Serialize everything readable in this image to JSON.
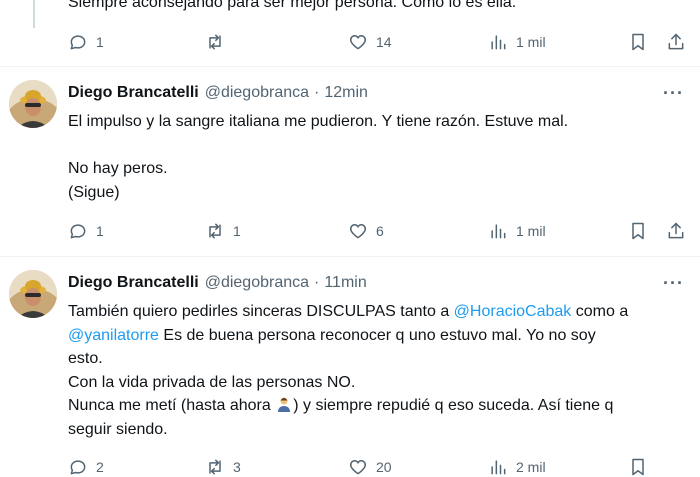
{
  "top_tweet": {
    "partial_text": "Siempre aconsejando para ser mejor persona. Como lo es ella.",
    "replies": "1",
    "retweets": "",
    "likes": "14",
    "views": "1 mil"
  },
  "tweets": [
    {
      "name": "Diego Brancatelli",
      "handle": "@diegobranca",
      "separator": "·",
      "time": "12min",
      "lines": [
        "El impulso y la sangre italiana me pudieron. Y tiene razón. Estuve mal.",
        "",
        "No hay peros.",
        "(Sigue)"
      ],
      "replies": "1",
      "retweets": "1",
      "likes": "6",
      "views": "1 mil"
    },
    {
      "name": "Diego Brancatelli",
      "handle": "@diegobranca",
      "separator": "·",
      "time": "11min",
      "text_a": "También quiero pedirles sinceras DISCULPAS tanto a ",
      "mention_1": "@HoracioCabak",
      "text_b": " como a",
      "mention_2": "@yanilatorre",
      "text_c": " Es de buena persona reconocer q uno estuvo mal. Yo no soy",
      "text_d": "esto.",
      "text_e": "Con la vida privada de las personas NO.",
      "text_f": "Nunca me metí (hasta ahora ",
      "text_g": ") y siempre repudié q eso suceda. Así tiene q",
      "text_h": "seguir siendo.",
      "replies": "2",
      "retweets": "3",
      "likes": "20",
      "views": "2 mil"
    }
  ],
  "more_label": "···",
  "colors": {
    "accent": "#1d9bf0",
    "muted": "#536471",
    "text": "#0f1419",
    "divider": "#eff3f4"
  }
}
